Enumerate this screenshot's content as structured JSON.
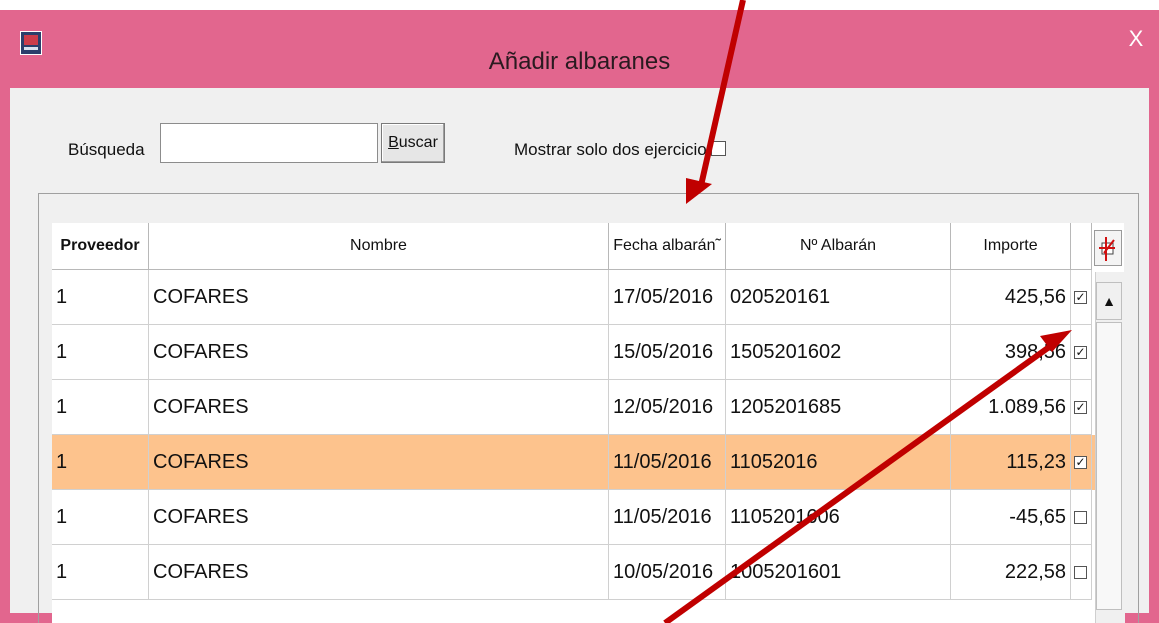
{
  "window": {
    "title": "Añadir albaranes",
    "close_label": "X"
  },
  "search": {
    "label": "Búsqueda",
    "value": "",
    "placeholder": "",
    "button_pre": "",
    "button_mnemonic": "B",
    "button_rest": "uscar"
  },
  "filter": {
    "label": "Mostrar solo dos ejercicios",
    "checked": false
  },
  "table": {
    "headers": {
      "proveedor": "Proveedor",
      "nombre": "Nombre",
      "fecha": "Fecha albarán˜",
      "numero": "Nº Albarán",
      "importe": "Importe"
    },
    "rows": [
      {
        "proveedor": "1",
        "nombre": "COFARES",
        "fecha": "17/05/2016",
        "numero": "020520161",
        "importe": "425,56",
        "checked": "✓"
      },
      {
        "proveedor": "1",
        "nombre": "COFARES",
        "fecha": "15/05/2016",
        "numero": "1505201602",
        "importe": "398,56",
        "checked": "✓"
      },
      {
        "proveedor": "1",
        "nombre": "COFARES",
        "fecha": "12/05/2016",
        "numero": "1205201685",
        "importe": "1.089,56",
        "checked": "✓"
      },
      {
        "proveedor": "1",
        "nombre": "COFARES",
        "fecha": "11/05/2016",
        "numero": "11052016",
        "importe": "115,23",
        "checked": "✓"
      },
      {
        "proveedor": "1",
        "nombre": "COFARES",
        "fecha": "11/05/2016",
        "numero": "1105201606",
        "importe": "-45,65",
        "checked": ""
      },
      {
        "proveedor": "1",
        "nombre": "COFARES",
        "fecha": "10/05/2016",
        "numero": "1005201601",
        "importe": "222,58",
        "checked": ""
      }
    ],
    "selected_row_index": 3
  },
  "scrollbar": {
    "up_glyph": "▲"
  },
  "colors": {
    "titlebar": "#e2668e",
    "selected_row": "#fdc38d",
    "annotation_arrow": "#c00000"
  }
}
